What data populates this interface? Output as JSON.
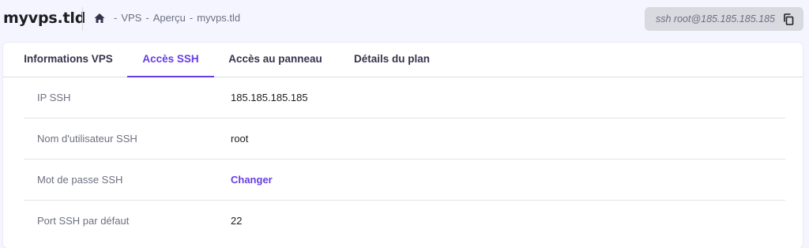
{
  "header": {
    "title": "myvps.tld",
    "breadcrumb": [
      "VPS",
      "Aperçu",
      "myvps.tld"
    ],
    "separator": "-",
    "ssh_command": "ssh root@185.185.185.185"
  },
  "tabs": [
    {
      "label": "Informations VPS",
      "active": false
    },
    {
      "label": "Accès SSH",
      "active": true
    },
    {
      "label": "Accès au panneau",
      "active": false
    },
    {
      "label": "Détails du plan",
      "active": false
    }
  ],
  "rows": [
    {
      "label": "IP SSH",
      "value": "185.185.185.185"
    },
    {
      "label": "Nom d'utilisateur SSH",
      "value": "root"
    },
    {
      "label": "Mot de passe SSH",
      "link": "Changer"
    },
    {
      "label": "Port SSH par défaut",
      "value": "22"
    }
  ],
  "icons": {
    "home": "home-icon",
    "copy": "copy-icon"
  },
  "colors": {
    "accent": "#673de6",
    "background": "#f4f5fe",
    "ssh_box": "#d8dae0"
  }
}
